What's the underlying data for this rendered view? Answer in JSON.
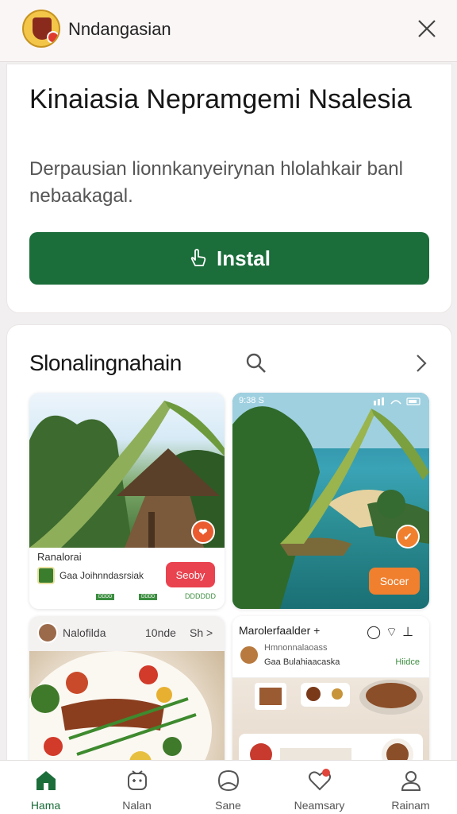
{
  "header": {
    "app_name": "Nndangasian",
    "close_icon": "close-icon"
  },
  "promo": {
    "headline": "Kinaiasia Nepramgemi Nsalesia",
    "description": "Derpausian lionnkanyeirynan hlolahkair banl nebaakagal.",
    "install_label": "Instal",
    "install_icon": "hand-pointer-icon",
    "accent": "#1b6d3a"
  },
  "section": {
    "title": "Slonalingnahain",
    "tiles": [
      {
        "name": "Ranalorai",
        "developer": "Gaa Joihnndasrsiak",
        "button_label": "Seoby",
        "button_color": "#e9434f",
        "tags": [
          "DDDD",
          "DDDD"
        ],
        "size": "DDDDDD"
      },
      {
        "status_left": "9:38 S",
        "button_label": "Socer",
        "button_color": "#f07f2e"
      },
      {
        "author": "Nalofilda",
        "count": "10nde",
        "more": "Sh >"
      },
      {
        "title": "Marolerfaalder +",
        "subtitle": "Hmnonnalaoass",
        "developer": "Gaa Bulahiaacaska",
        "rating": "Hiidce"
      }
    ]
  },
  "nav": {
    "items": [
      {
        "label": "Hama",
        "icon": "home-icon",
        "active": true
      },
      {
        "label": "Nalan",
        "icon": "games-icon",
        "active": false
      },
      {
        "label": "Sane",
        "icon": "apps-icon",
        "active": false
      },
      {
        "label": "Neamsary",
        "icon": "heart-icon",
        "active": false
      },
      {
        "label": "Rainam",
        "icon": "profile-icon",
        "active": false
      }
    ]
  }
}
